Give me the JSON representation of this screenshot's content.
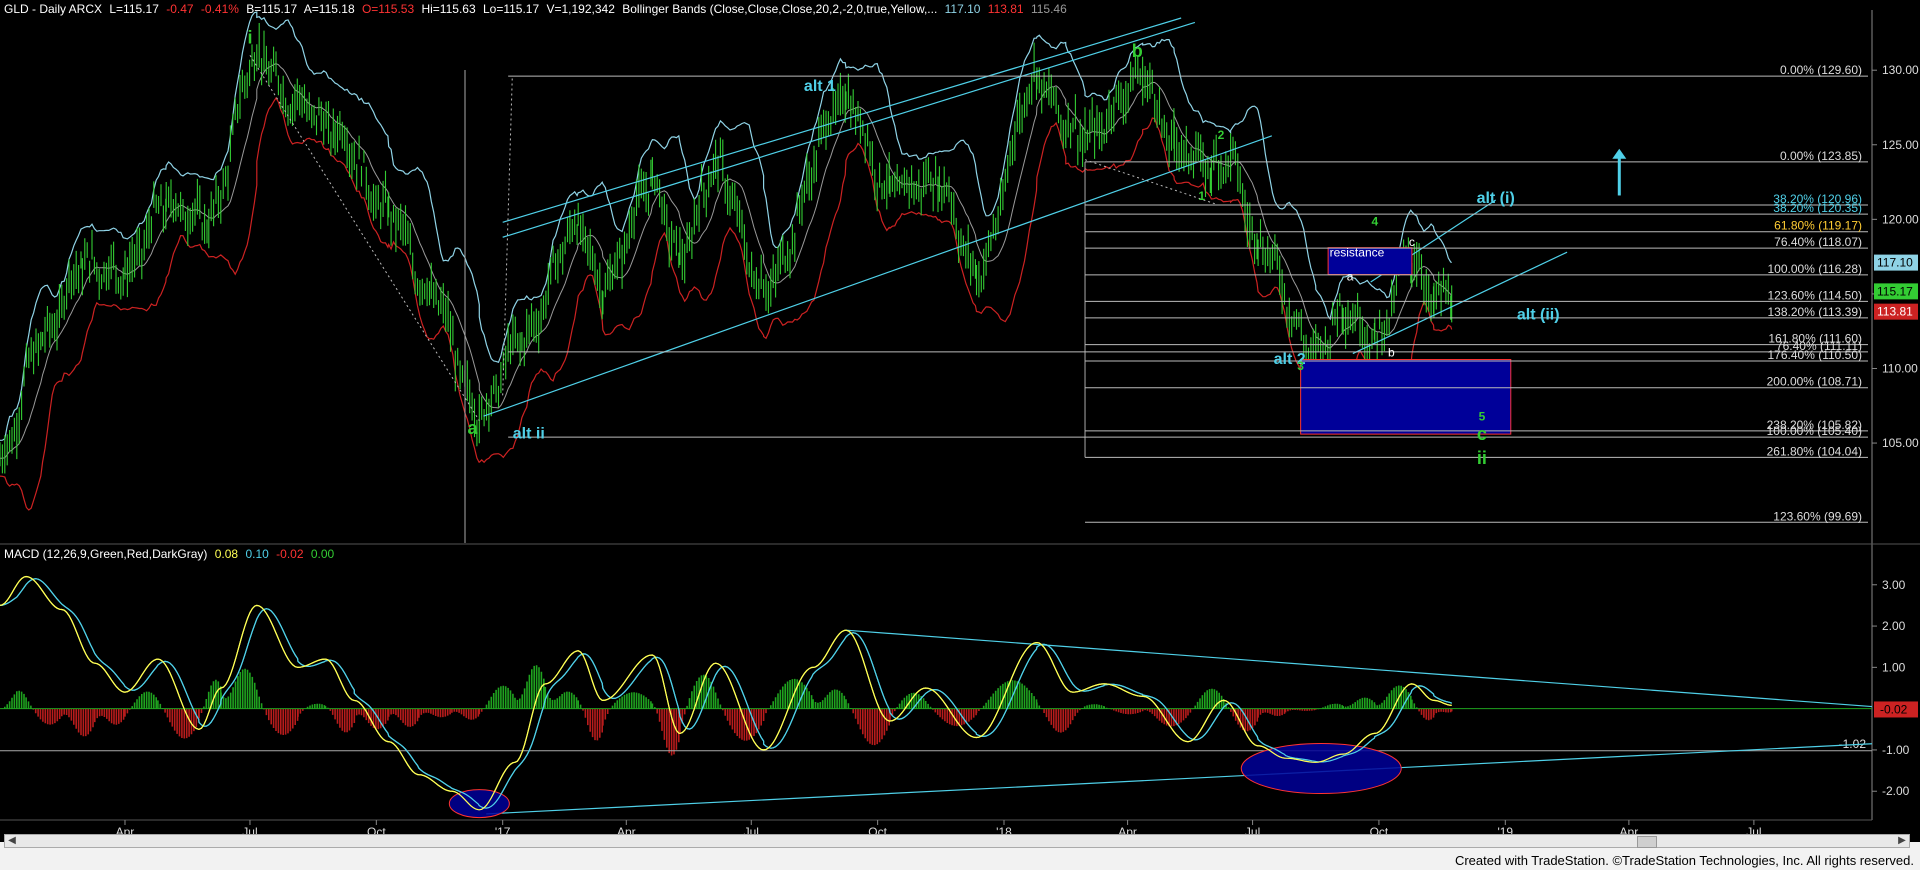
{
  "header": {
    "symbol_info": "GLD - Daily ARCX",
    "last": "L=115.17",
    "change": "-0.47",
    "change_pct": "-0.41%",
    "bid": "B=115.17",
    "ask": "A=115.18",
    "open": "O=115.53",
    "high": "Hi=115.63",
    "low": "Lo=115.17",
    "volume": "V=1,192,342",
    "study": "Bollinger Bands (Close,Close,Close,20,2,-2,0,true,Yellow,...",
    "bb_upper": "117.10",
    "bb_lower": "113.81",
    "bb_mid": "115.46"
  },
  "macd_header": {
    "label": "MACD (12,26,9,Green,Red,DarkGray)",
    "v1": "0.08",
    "v2": "0.10",
    "v3": "-0.02",
    "v4": "0.00"
  },
  "colors": {
    "price": "#33cc33",
    "upper_band": "#8fd3e6",
    "lower_band": "#cc2222",
    "mid_band": "#999999",
    "cyan": "#4fd0e8",
    "green": "#33cc33",
    "navy": "#000099",
    "red": "#ff2222",
    "yellow": "#ffff55"
  },
  "footer": "Created with TradeStation. ©TradeStation Technologies, Inc. All rights reserved.",
  "chart_data": [
    {
      "type": "line",
      "title": "GLD - Daily ARCX",
      "ylim": [
        98.5,
        133.5
      ],
      "y_ticks": [
        105.0,
        110.0,
        115.0,
        120.0,
        125.0,
        130.0
      ],
      "x_ticks": [
        "Apr",
        "Jul",
        "Oct",
        "'17",
        "Apr",
        "Jul",
        "Oct",
        "'18",
        "Apr",
        "Jul",
        "Oct",
        "'19",
        "Apr",
        "Jul"
      ],
      "price_path": [
        [
          "2016-01-01",
          104.0
        ],
        [
          "2016-02-01",
          112.0
        ],
        [
          "2016-03-01",
          117.0
        ],
        [
          "2016-04-01",
          116.5
        ],
        [
          "2016-05-01",
          121.0
        ],
        [
          "2016-06-01",
          120.0
        ],
        [
          "2016-07-06",
          131.0
        ],
        [
          "2016-08-01",
          128.0
        ],
        [
          "2016-09-01",
          126.0
        ],
        [
          "2016-10-10",
          120.5
        ],
        [
          "2016-11-10",
          115.0
        ],
        [
          "2016-12-15",
          107.0
        ],
        [
          "2017-01-15",
          112.0
        ],
        [
          "2017-02-25",
          119.5
        ],
        [
          "2017-03-15",
          115.5
        ],
        [
          "2017-04-20",
          122.5
        ],
        [
          "2017-05-10",
          117.5
        ],
        [
          "2017-06-05",
          123.5
        ],
        [
          "2017-07-10",
          115.5
        ],
        [
          "2017-09-08",
          128.0
        ],
        [
          "2017-10-10",
          122.0
        ],
        [
          "2017-11-15",
          122.5
        ],
        [
          "2017-12-12",
          116.5
        ],
        [
          "2018-01-25",
          129.5
        ],
        [
          "2018-02-15",
          126.5
        ],
        [
          "2018-03-01",
          125.5
        ],
        [
          "2018-04-12",
          129.5
        ],
        [
          "2018-05-05",
          125.0
        ],
        [
          "2018-06-01",
          123.5
        ],
        [
          "2018-06-15",
          124.0
        ],
        [
          "2018-07-05",
          118.5
        ],
        [
          "2018-08-16",
          111.0
        ],
        [
          "2018-09-05",
          114.0
        ],
        [
          "2018-09-28",
          112.0
        ],
        [
          "2018-10-25",
          117.5
        ],
        [
          "2018-11-10",
          114.5
        ],
        [
          "2018-11-23",
          115.17
        ]
      ],
      "bollinger_upper": "117.10",
      "bollinger_lower": "113.81",
      "bollinger_mid": "115.46",
      "price_badges": [
        {
          "label": "117.10",
          "value": 117.1,
          "color": "#8fd3e6"
        },
        {
          "label": "115.17",
          "value": 115.17,
          "color": "#33cc33"
        },
        {
          "label": "113.81",
          "value": 113.81,
          "color": "#cc2222"
        }
      ],
      "fib_levels": [
        {
          "label": "0.00% (129.60)",
          "value": 129.6
        },
        {
          "label": "0.00% (123.85)",
          "value": 123.85
        },
        {
          "label": "38.20% (120.96)",
          "value": 120.96
        },
        {
          "label": "38.20% (120.35)",
          "value": 120.35
        },
        {
          "label": "61.80% (119.17)",
          "value": 119.17
        },
        {
          "label": "76.40% (118.07)",
          "value": 118.07
        },
        {
          "label": "100.00% (116.28)",
          "value": 116.28
        },
        {
          "label": "123.60% (114.50)",
          "value": 114.5
        },
        {
          "label": "138.20% (113.39)",
          "value": 113.39
        },
        {
          "label": "161.80% (111.60)",
          "value": 111.6
        },
        {
          "label": "76.40% (111.11)",
          "value": 111.11
        },
        {
          "label": "176.40% (110.50)",
          "value": 110.5
        },
        {
          "label": "200.00% (108.71)",
          "value": 108.71
        },
        {
          "label": "238.20% (105.82)",
          "value": 105.82
        },
        {
          "label": "100.00% (105.40)",
          "value": 105.4
        },
        {
          "label": "261.80% (104.04)",
          "value": 104.04
        },
        {
          "label": "123.60% (99.69)",
          "value": 99.69
        }
      ],
      "annotations": [
        {
          "text": "i",
          "color": "green",
          "date": "2016-07-01",
          "value": 131.8
        },
        {
          "text": "a",
          "color": "green",
          "date": "2016-12-10",
          "value": 105.6
        },
        {
          "text": "alt ii",
          "color": "cyan",
          "date": "2017-01-20",
          "value": 105.3
        },
        {
          "text": "alt 1",
          "color": "cyan",
          "date": "2017-08-20",
          "value": 128.6
        },
        {
          "text": "b",
          "color": "green",
          "date": "2018-04-08",
          "value": 130.9
        },
        {
          "text": "2",
          "color": "green",
          "date": "2018-06-08",
          "value": 125.4
        },
        {
          "text": "1",
          "color": "green",
          "date": "2018-05-25",
          "value": 121.3
        },
        {
          "text": "4",
          "color": "green",
          "date": "2018-09-28",
          "value": 119.6
        },
        {
          "text": "resistance",
          "color": "white",
          "date": "2018-09-15",
          "value": 117.5
        },
        {
          "text": "c",
          "color": "white",
          "date": "2018-10-25",
          "value": 118.2
        },
        {
          "text": "a",
          "color": "white",
          "date": "2018-09-10",
          "value": 115.9
        },
        {
          "text": "b",
          "color": "white",
          "date": "2018-10-10",
          "value": 110.8
        },
        {
          "text": "alt 2",
          "color": "cyan",
          "date": "2018-07-28",
          "value": 110.3
        },
        {
          "text": "3",
          "color": "green",
          "date": "2018-08-05",
          "value": 109.9
        },
        {
          "text": "alt (i)",
          "color": "cyan",
          "date": "2018-12-25",
          "value": 121.1
        },
        {
          "text": "alt (ii)",
          "color": "cyan",
          "date": "2019-01-25",
          "value": 113.3
        },
        {
          "text": "5",
          "color": "green",
          "date": "2018-12-15",
          "value": 106.5
        },
        {
          "text": "c",
          "color": "green",
          "date": "2018-12-15",
          "value": 105.2
        },
        {
          "text": "ii",
          "color": "green",
          "date": "2018-12-15",
          "value": 103.6
        }
      ],
      "target_boxes": [
        {
          "label": "resistance",
          "from": "2018-08-25",
          "to": "2018-10-25",
          "low": 116.3,
          "high": 118.1
        },
        {
          "label": "",
          "from": "2018-08-05",
          "to": "2019-01-05",
          "low": 105.6,
          "high": 110.6
        }
      ],
      "grid": false
    },
    {
      "type": "line",
      "title": "MACD (12,26,9,Green,Red,DarkGray)",
      "ylim": [
        -2.6,
        3.6
      ],
      "y_ticks": [
        -2.0,
        -1.0,
        1.0,
        2.0,
        3.0
      ],
      "last_values": [
        "0.08",
        "0.10",
        "-0.02",
        "0.00"
      ],
      "macd_path": [
        [
          "2016-01-01",
          2.5
        ],
        [
          "2016-01-20",
          3.2
        ],
        [
          "2016-02-15",
          2.4
        ],
        [
          "2016-03-10",
          1.1
        ],
        [
          "2016-04-01",
          0.4
        ],
        [
          "2016-04-25",
          1.2
        ],
        [
          "2016-05-25",
          -0.5
        ],
        [
          "2016-06-10",
          0.5
        ],
        [
          "2016-07-06",
          2.5
        ],
        [
          "2016-08-05",
          1.0
        ],
        [
          "2016-08-25",
          1.2
        ],
        [
          "2016-09-15",
          0.2
        ],
        [
          "2016-10-10",
          -0.8
        ],
        [
          "2016-11-01",
          -1.6
        ],
        [
          "2016-11-25",
          -2.0
        ],
        [
          "2016-12-15",
          -2.45
        ],
        [
          "2017-01-10",
          -1.3
        ],
        [
          "2017-02-01",
          0.6
        ],
        [
          "2017-02-25",
          1.4
        ],
        [
          "2017-03-15",
          0.2
        ],
        [
          "2017-04-20",
          1.3
        ],
        [
          "2017-05-10",
          -0.6
        ],
        [
          "2017-06-05",
          1.1
        ],
        [
          "2017-07-10",
          -1.0
        ],
        [
          "2017-08-15",
          1.0
        ],
        [
          "2017-09-08",
          1.9
        ],
        [
          "2017-10-10",
          -0.3
        ],
        [
          "2017-11-05",
          0.5
        ],
        [
          "2017-12-12",
          -0.7
        ],
        [
          "2018-01-25",
          1.6
        ],
        [
          "2018-02-20",
          0.4
        ],
        [
          "2018-03-15",
          0.6
        ],
        [
          "2018-04-12",
          0.3
        ],
        [
          "2018-05-15",
          -0.8
        ],
        [
          "2018-06-10",
          0.2
        ],
        [
          "2018-07-05",
          -0.9
        ],
        [
          "2018-07-25",
          -1.2
        ],
        [
          "2018-08-16",
          -1.3
        ],
        [
          "2018-09-05",
          -1.1
        ],
        [
          "2018-09-28",
          -0.6
        ],
        [
          "2018-10-25",
          0.6
        ],
        [
          "2018-11-10",
          0.2
        ],
        [
          "2018-11-23",
          0.08
        ]
      ],
      "hline": {
        "label": "-1.02",
        "value": -1.02
      },
      "value_badge": {
        "label": "-0.02",
        "value": -0.02
      },
      "grid": false
    }
  ]
}
